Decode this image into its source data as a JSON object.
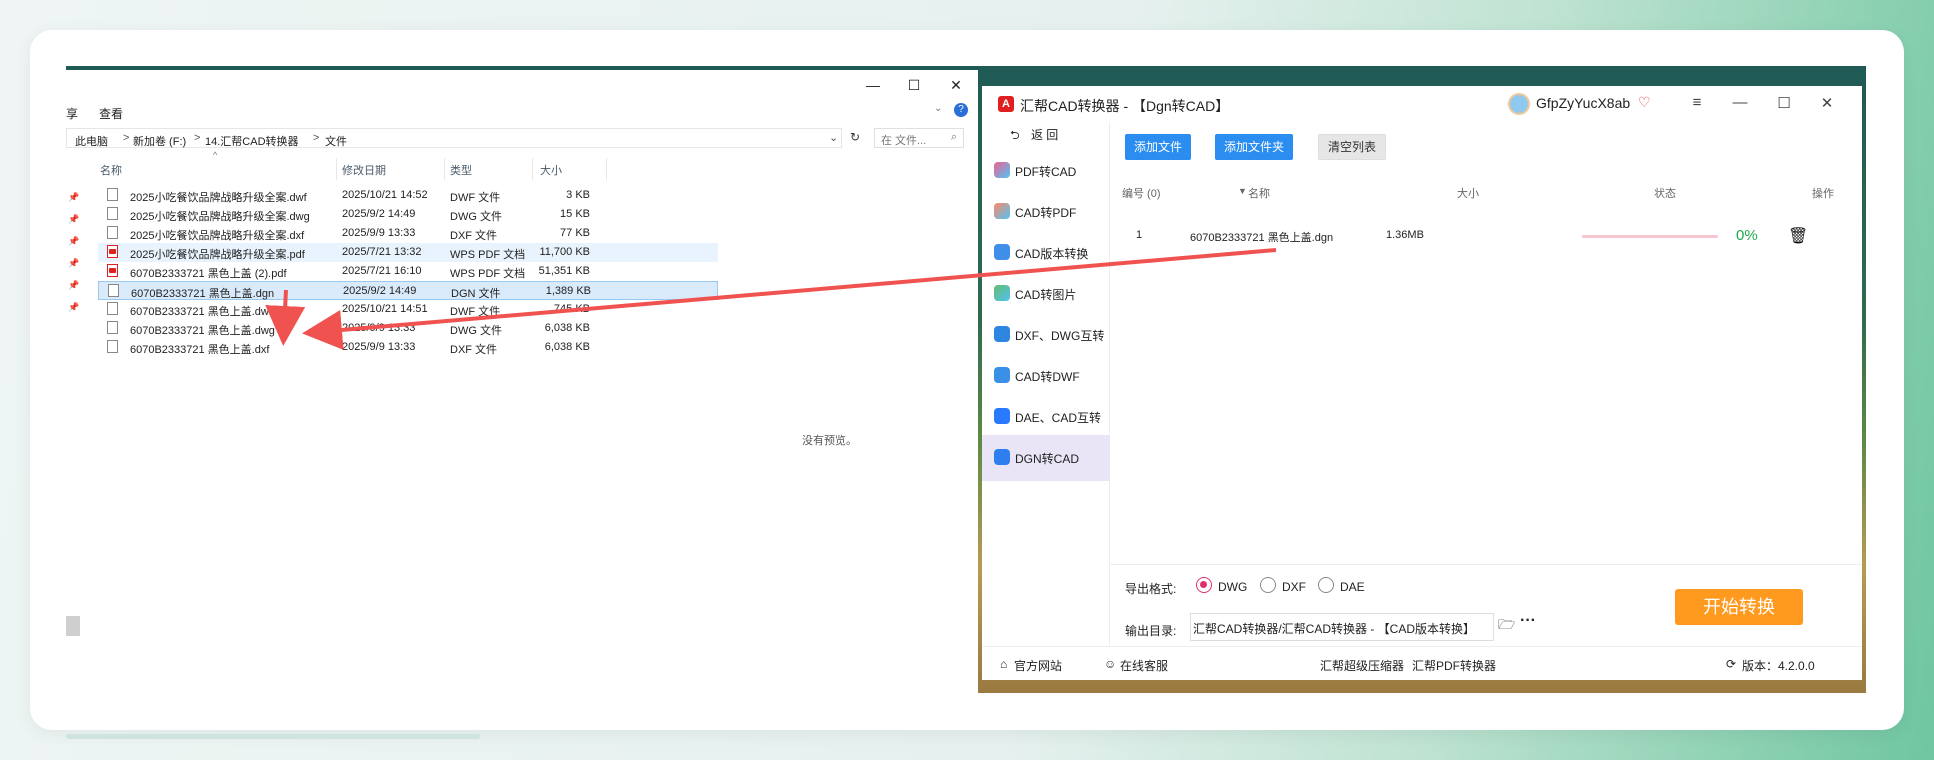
{
  "explorer": {
    "window_controls": [
      "—",
      "☐",
      "✕"
    ],
    "ribbon": {
      "cut_label": "享",
      "view_label": "查看"
    },
    "address": {
      "crumbs": [
        "此电脑",
        "新加卷 (F:)",
        "14.汇帮CAD转换器",
        "文件"
      ],
      "separator": ">",
      "search_placeholder": "在 文件..."
    },
    "columns": {
      "name": "名称",
      "modified": "修改日期",
      "type": "类型",
      "size": "大小"
    },
    "files": [
      {
        "name": "2025小吃餐饮品牌战略升级全案.dwf",
        "modified": "2025/10/21 14:52",
        "type": "DWF 文件",
        "size": "3 KB",
        "icon": "file-icon"
      },
      {
        "name": "2025小吃餐饮品牌战略升级全案.dwg",
        "modified": "2025/9/2 14:49",
        "type": "DWG 文件",
        "size": "15 KB",
        "icon": "file-icon"
      },
      {
        "name": "2025小吃餐饮品牌战略升级全案.dxf",
        "modified": "2025/9/9 13:33",
        "type": "DXF 文件",
        "size": "77 KB",
        "icon": "file-icon"
      },
      {
        "name": "2025小吃餐饮品牌战略升级全案.pdf",
        "modified": "2025/7/21 13:32",
        "type": "WPS PDF 文档",
        "size": "11,700 KB",
        "icon": "pdf-icon"
      },
      {
        "name": "6070B2333721 黑色上盖 (2).pdf",
        "modified": "2025/7/21 16:10",
        "type": "WPS PDF 文档",
        "size": "51,351 KB",
        "icon": "pdf-icon"
      },
      {
        "name": "6070B2333721 黑色上盖.dgn",
        "modified": "2025/9/2 14:49",
        "type": "DGN 文件",
        "size": "1,389 KB",
        "icon": "file-icon"
      },
      {
        "name": "6070B2333721 黑色上盖.dwf",
        "modified": "2025/10/21 14:51",
        "type": "DWF 文件",
        "size": "745 KB",
        "icon": "file-icon"
      },
      {
        "name": "6070B2333721 黑色上盖.dwg",
        "modified": "2025/9/9 13:33",
        "type": "DWG 文件",
        "size": "6,038 KB",
        "icon": "file-icon"
      },
      {
        "name": "6070B2333721 黑色上盖.dxf",
        "modified": "2025/9/9 13:33",
        "type": "DXF 文件",
        "size": "6,038 KB",
        "icon": "file-icon"
      }
    ],
    "selected_index": 5,
    "no_preview": "没有预览。"
  },
  "converter": {
    "title": "汇帮CAD转换器 - 【Dgn转CAD】",
    "username": "GfpZyYucX8ab",
    "window_controls": [
      "≡",
      "—",
      "☐",
      "✕"
    ],
    "back_label": "返 回",
    "sidebar": [
      {
        "label": "PDF转CAD",
        "icon": "pdf-to-cad-icon"
      },
      {
        "label": "CAD转PDF",
        "icon": "cad-to-pdf-icon"
      },
      {
        "label": "CAD版本转换",
        "icon": "cad-version-icon"
      },
      {
        "label": "CAD转图片",
        "icon": "cad-to-image-icon"
      },
      {
        "label": "DXF、DWG互转",
        "icon": "dxf-dwg-icon"
      },
      {
        "label": "CAD转DWF",
        "icon": "cad-to-dwf-icon"
      },
      {
        "label": "DAE、CAD互转",
        "icon": "dae-cad-icon"
      },
      {
        "label": "DGN转CAD",
        "icon": "dgn-to-cad-icon"
      }
    ],
    "active_sidebar_index": 7,
    "toolbar": {
      "add_file": "添加文件",
      "add_folder": "添加文件夹",
      "clear_list": "清空列表"
    },
    "table_headers": {
      "index": "编号 (0)",
      "name": "名称",
      "size": "大小",
      "status": "状态",
      "action": "操作"
    },
    "rows": [
      {
        "index": "1",
        "name": "6070B2333721 黑色上盖.dgn",
        "size": "1.36MB",
        "progress_text": "0%",
        "progress": 0
      }
    ],
    "export_format_label": "导出格式:",
    "formats": [
      "DWG",
      "DXF",
      "DAE"
    ],
    "selected_format": "DWG",
    "output_dir_label": "输出目录:",
    "output_dir_value": "汇帮CAD转换器/汇帮CAD转换器 - 【CAD版本转换】",
    "start_button": "开始转换",
    "footer": {
      "website": "官方网站",
      "support": "在线客服",
      "compressor": "汇帮超级压缩器",
      "pdf_converter": "汇帮PDF转换器",
      "version": "版本：4.2.0.0"
    },
    "colors": {
      "accent_blue": "#2b8df0",
      "start_orange": "#ff9a1e",
      "progress_green": "#1fa84a",
      "radio_pink": "#e0306a"
    }
  },
  "annotation": {
    "arrow_color": "#f0524f"
  }
}
